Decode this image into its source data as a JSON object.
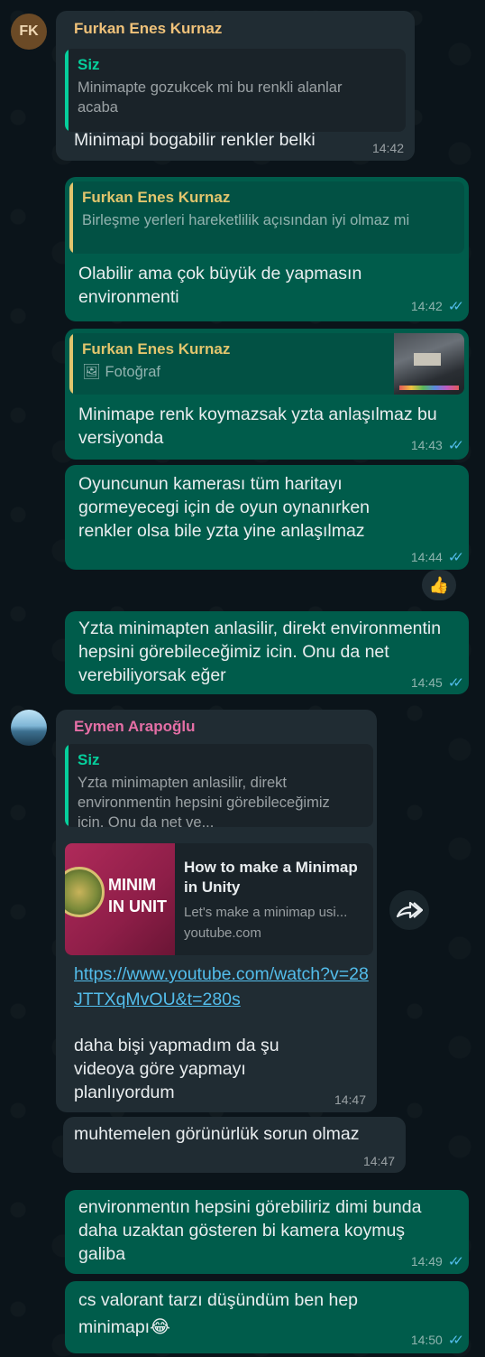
{
  "m1": {
    "initials": "FK",
    "sender": "Furkan Enes Kurnaz",
    "quote_name": "Siz",
    "quote_text": "Minimapte gozukcek mi bu renkli alanlar acaba",
    "text": "Minimapi bogabilir renkler belki",
    "time": "14:42"
  },
  "m2": {
    "quote_name": "Furkan Enes Kurnaz",
    "quote_text": "Birleşme yerleri hareketlilik açısından iyi olmaz mi",
    "text": "Olabilir ama çok büyük de yapmasın environmenti",
    "time": "14:42"
  },
  "m3": {
    "quote_name": "Furkan Enes Kurnaz",
    "quote_text": "Fotoğraf",
    "text": "Minimape renk koymazsak yzta anlaşılmaz bu versiyonda",
    "time": "14:43"
  },
  "m4": {
    "text": "Oyuncunun kamerası tüm haritayı gormeyecegi için de oyun oynanırken renkler olsa bile yzta yine anlaşılmaz",
    "time": "14:44",
    "reaction": "👍"
  },
  "m5": {
    "text": "Yzta minimapten anlasilir, direkt environmentin hepsini görebileceğimiz icin. Onu da net verebiliyorsak eğer",
    "time": "14:45"
  },
  "m6": {
    "sender": "Eymen Arapoğlu",
    "quote_name": "Siz",
    "quote_text": "Yzta minimapten anlasilir, direkt environmentin hepsini görebileceğimiz icin. Onu da net ve...",
    "preview": {
      "thumb_line1": "MINIM",
      "thumb_line2": "IN UNIT",
      "title": "How to make a Minimap in Unity",
      "desc": "Let's make a minimap usi...",
      "domain": "youtube.com"
    },
    "link": "https://www.youtube.com/watch?v=28JTTXqMvOU&t=280s",
    "text": "daha bişi yapmadım da şu videoya göre yapmayı planlıyordum",
    "time": "14:47"
  },
  "m7": {
    "text": "muhtemelen görünürlük sorun olmaz",
    "time": "14:47"
  },
  "m8": {
    "text": "environmentın hepsini görebiliriz dimi bunda daha uzaktan gösteren bi kamera koymuş galiba",
    "time": "14:49"
  },
  "m9": {
    "text": "cs valorant tarzı düşündüm ben hep minimapı😂",
    "time": "14:50"
  },
  "colors": {
    "furkan_name": "#f0c27a",
    "eymen_name": "#e56fa6",
    "incoming_bubble": "#202c33",
    "outgoing_bubble": "#005c4b",
    "read_ticks": "#53bdeb"
  }
}
